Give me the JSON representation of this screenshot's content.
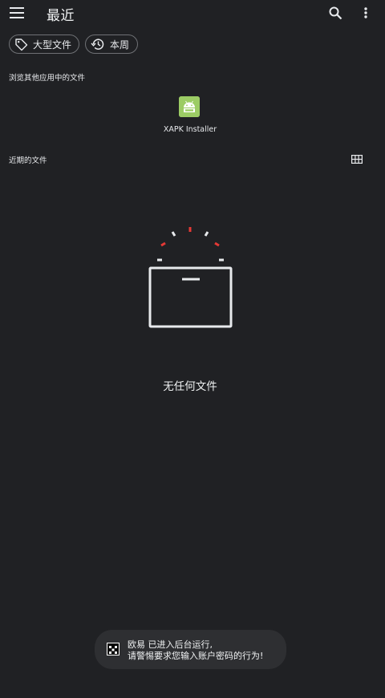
{
  "appbar": {
    "title": "最近",
    "menu_icon": "menu-icon",
    "search_icon": "search-icon",
    "more_icon": "more-vert-icon"
  },
  "chips": [
    {
      "label": "大型文件",
      "icon": "tag-icon"
    },
    {
      "label": "本周",
      "icon": "history-icon"
    }
  ],
  "browse_section": {
    "title": "浏览其他应用中的文件",
    "apps": [
      {
        "label": "XAPK Installer",
        "icon": "android-icon",
        "color": "#9ccc65"
      }
    ]
  },
  "recent_section": {
    "title": "近期的文件",
    "view_toggle_icon": "grid-view-icon"
  },
  "empty_state": {
    "text": "无任何文件",
    "illustration": "empty-box-icon",
    "accent_color": "#e53935"
  },
  "toast": {
    "app_name": "欧易",
    "line1": "欧易 已进入后台运行,",
    "line2": "请警惕要求您输入账户密码的行为!"
  }
}
